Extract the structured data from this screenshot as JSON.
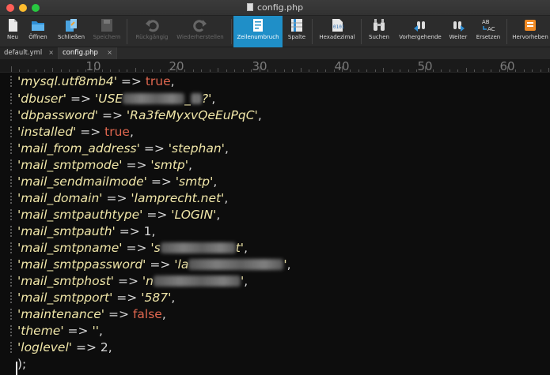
{
  "window": {
    "title": "config.php"
  },
  "toolbar": {
    "neu": "Neu",
    "oeffnen": "Öffnen",
    "schliessen": "Schließen",
    "speichern": "Speichern",
    "rueckgaengig": "Rückgängig",
    "wiederherstellen": "Wiederherstellen",
    "zeilenumbruch": "Zeilenumbruch",
    "spalte": "Spalte",
    "hexadezimal": "Hexadezimal",
    "suchen": "Suchen",
    "vorhergehende": "Vorhergehende",
    "weiter": "Weiter",
    "ersetzen": "Ersetzen",
    "hervorheben": "Hervorheben"
  },
  "tabs": {
    "t1": "default.yml",
    "t2": "config.php"
  },
  "ruler": {
    "r10": "10",
    "r20": "20",
    "r30": "30",
    "r40": "40",
    "r50": "50",
    "r60": "60"
  },
  "code": {
    "l1k": "'mysql.utf8mb4'",
    "l1v": "true",
    "l2k": "'dbuser'",
    "l2v": "'USE",
    "l2v2": "_",
    "l2v3": "?'",
    "l3k": "'dbpassword'",
    "l3v": "'Ra3feMyxvQeEuPqC'",
    "l4k": "'installed'",
    "l4v": "true",
    "l5k": "'mail_from_address'",
    "l5v": "'stephan'",
    "l6k": "'mail_smtpmode'",
    "l6v": "'smtp'",
    "l7k": "'mail_sendmailmode'",
    "l7v": "'smtp'",
    "l8k": "'mail_domain'",
    "l8v": "'lamprecht.net'",
    "l9k": "'mail_smtpauthtype'",
    "l9v": "'LOGIN'",
    "l10k": "'mail_smtpauth'",
    "l10v": "1",
    "l11k": "'mail_smtpname'",
    "l11v": "'s",
    "l11v2": "t'",
    "l12k": "'mail_smtppassword'",
    "l12v": "'la",
    "l12v2": "'",
    "l13k": "'mail_smtphost'",
    "l13v": "'n",
    "l13v2": "'",
    "l14k": "'mail_smtpport'",
    "l14v": "'587'",
    "l15k": "'maintenance'",
    "l15v": "false",
    "l16k": "'theme'",
    "l16v": "''",
    "l17k": "'loglevel'",
    "l17v": "2",
    "arrow": "=>",
    "comma": ",",
    "end": ");"
  },
  "colors": {
    "key": "#f0e6a8",
    "keyword": "#e0674f",
    "accent": "#1f8fc8"
  },
  "icons": [
    "new-file-icon",
    "open-folder-icon",
    "close-file-icon",
    "save-icon",
    "undo-icon",
    "redo-icon",
    "word-wrap-icon",
    "column-icon",
    "hex-icon",
    "search-icon",
    "previous-icon",
    "next-icon",
    "replace-icon",
    "highlight-icon"
  ]
}
